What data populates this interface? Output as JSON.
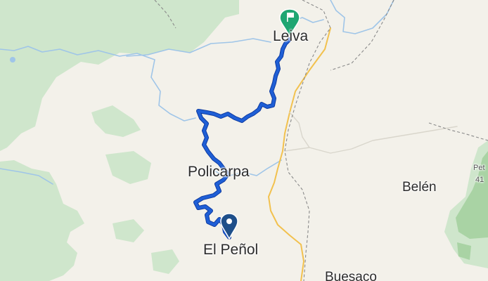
{
  "map": {
    "places": {
      "leiva": "Leiva",
      "policarpa": "Policarpa",
      "el_penol": "El Peñol",
      "belen": "Belén",
      "buesaco": "Buesaco",
      "edge_top": "Pet",
      "edge_bottom": "41"
    },
    "markers": {
      "start": "location-pin-icon",
      "finish": "finish-flag-icon"
    },
    "colors": {
      "route": "#1f5fd6",
      "route_outline": "#0d3aa0",
      "forest": "#cfe6cc",
      "forest_dark": "#a9d3a4",
      "river": "#9fc5e8",
      "land": "#f3f1ea",
      "road": "#f2c14e",
      "border": "#8a8a8a",
      "start_pin": "#1e4f8a",
      "finish_pin": "#1ea672"
    }
  }
}
